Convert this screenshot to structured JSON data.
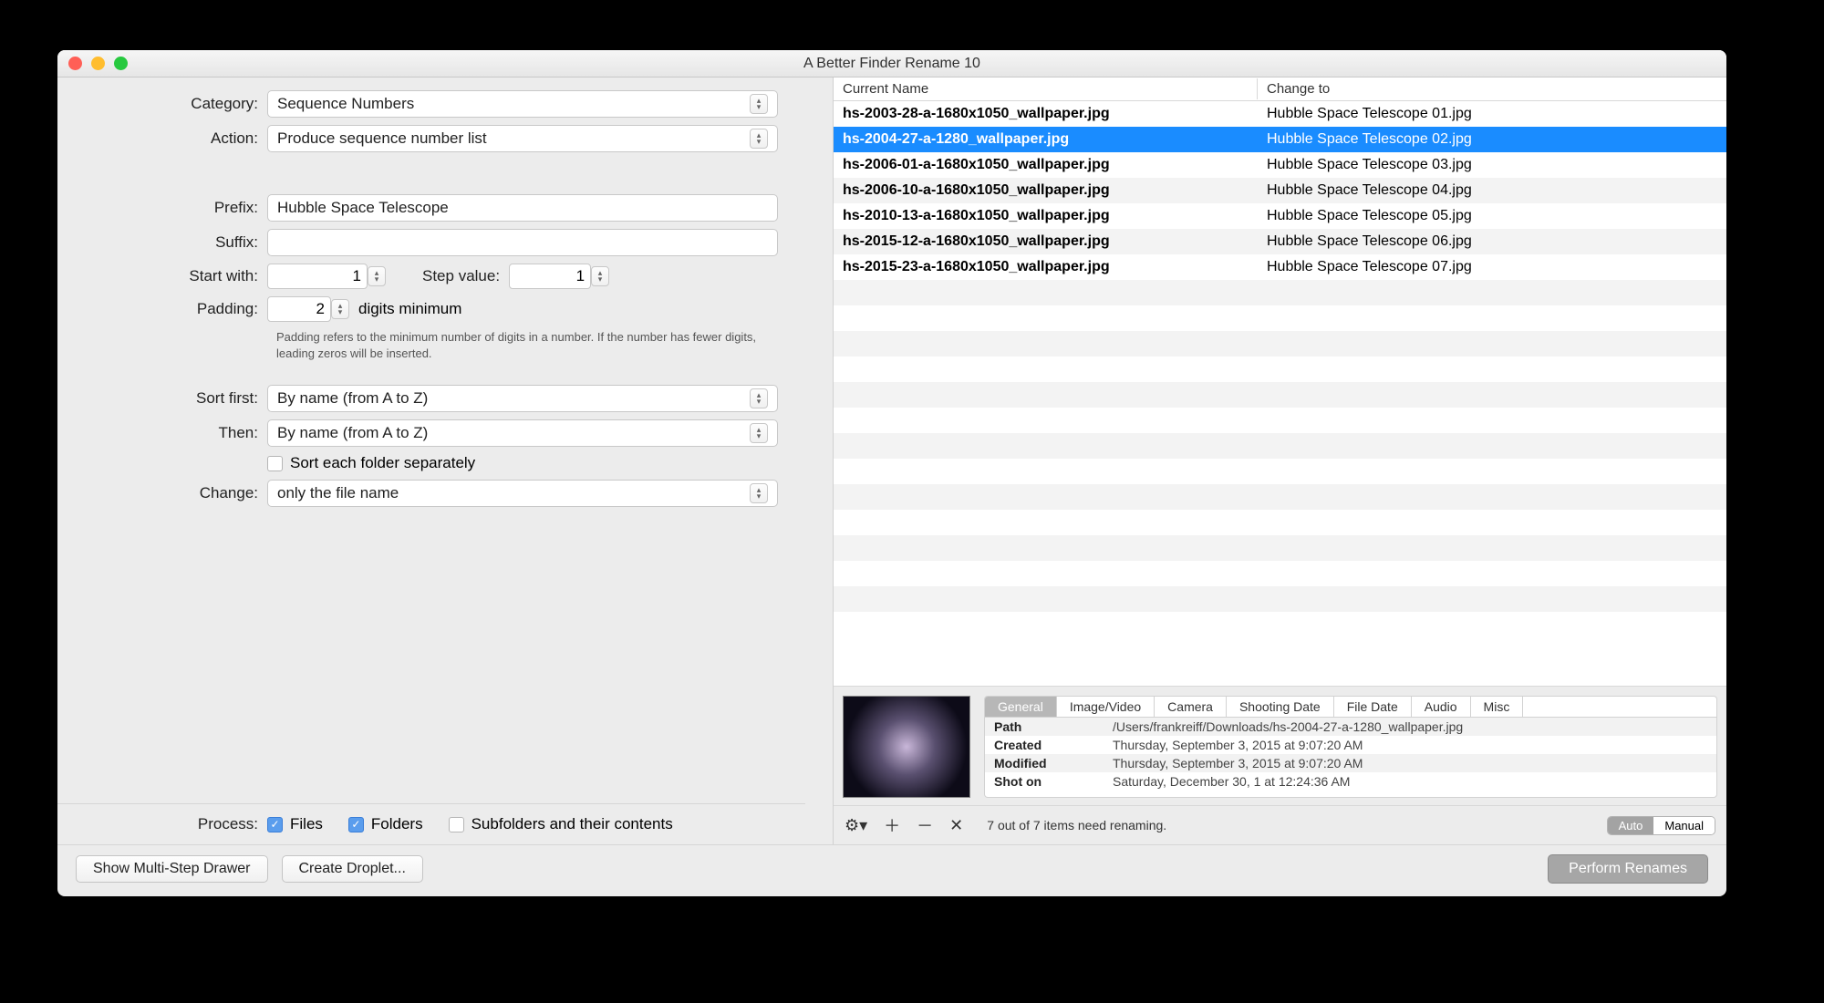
{
  "window": {
    "title": "A Better Finder Rename 10"
  },
  "form": {
    "category_label": "Category:",
    "category_value": "Sequence Numbers",
    "action_label": "Action:",
    "action_value": "Produce sequence number list",
    "prefix_label": "Prefix:",
    "prefix_value": "Hubble Space Telescope",
    "suffix_label": "Suffix:",
    "suffix_value": "",
    "start_label": "Start with:",
    "start_value": "1",
    "step_label": "Step value:",
    "step_value": "1",
    "padding_label": "Padding:",
    "padding_value": "2",
    "padding_tail": "digits minimum",
    "padding_hint": "Padding refers to the minimum number of digits in a number. If the number has fewer digits, leading zeros will be inserted.",
    "sort1_label": "Sort first:",
    "sort1_value": "By name (from A to Z)",
    "sort2_label": "Then:",
    "sort2_value": "By name (from A to Z)",
    "sort_each_label": "Sort each folder separately",
    "change_label": "Change:",
    "change_value": "only the file name"
  },
  "process": {
    "label": "Process:",
    "files": "Files",
    "folders": "Folders",
    "subfolders": "Subfolders and their contents"
  },
  "buttons": {
    "multi_step": "Show Multi-Step Drawer",
    "droplet": "Create Droplet...",
    "perform": "Perform Renames"
  },
  "table": {
    "colA": "Current Name",
    "colB": "Change to",
    "rows": [
      {
        "a": "hs-2003-28-a-1680x1050_wallpaper.jpg",
        "b": "Hubble Space Telescope 01.jpg"
      },
      {
        "a": "hs-2004-27-a-1280_wallpaper.jpg",
        "b": "Hubble Space Telescope 02.jpg"
      },
      {
        "a": "hs-2006-01-a-1680x1050_wallpaper.jpg",
        "b": "Hubble Space Telescope 03.jpg"
      },
      {
        "a": "hs-2006-10-a-1680x1050_wallpaper.jpg",
        "b": "Hubble Space Telescope 04.jpg"
      },
      {
        "a": "hs-2010-13-a-1680x1050_wallpaper.jpg",
        "b": "Hubble Space Telescope 05.jpg"
      },
      {
        "a": "hs-2015-12-a-1680x1050_wallpaper.jpg",
        "b": "Hubble Space Telescope 06.jpg"
      },
      {
        "a": "hs-2015-23-a-1680x1050_wallpaper.jpg",
        "b": "Hubble Space Telescope 07.jpg"
      }
    ],
    "selected_index": 1,
    "empty_rows": 13
  },
  "details": {
    "tabs": [
      "General",
      "Image/Video",
      "Camera",
      "Shooting Date",
      "File Date",
      "Audio",
      "Misc"
    ],
    "active_tab": 0,
    "rows": [
      {
        "k": "Path",
        "v": "/Users/frankreiff/Downloads/hs-2004-27-a-1280_wallpaper.jpg"
      },
      {
        "k": "Created",
        "v": "Thursday, September 3, 2015 at 9:07:20 AM"
      },
      {
        "k": "Modified",
        "v": "Thursday, September 3, 2015 at 9:07:20 AM"
      },
      {
        "k": "Shot on",
        "v": "Saturday, December 30, 1 at 12:24:36 AM"
      }
    ]
  },
  "toolbar2": {
    "status": "7 out of 7 items need renaming.",
    "auto": "Auto",
    "manual": "Manual"
  }
}
